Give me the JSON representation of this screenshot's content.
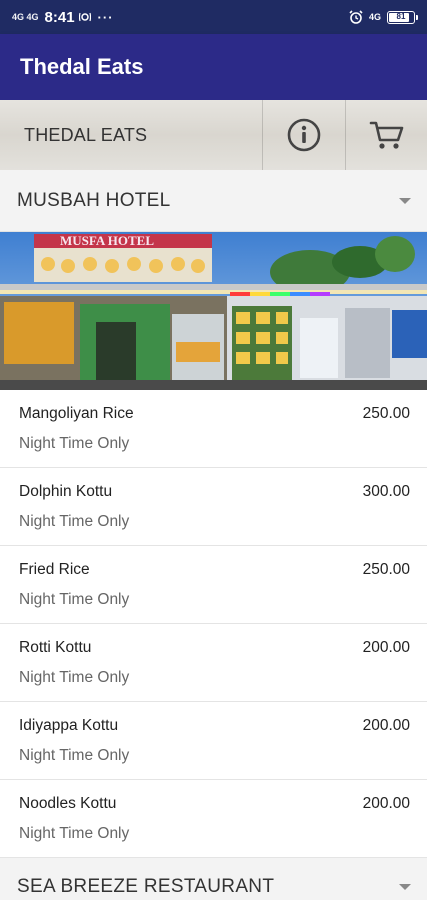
{
  "status_bar": {
    "signal_text": "4G 4G",
    "time": "8:41",
    "more": "···",
    "network": "4G",
    "battery": "81"
  },
  "app_bar": {
    "title": "Thedal Eats"
  },
  "toolbar": {
    "title": "THEDAL EATS",
    "info_icon": "info-icon",
    "cart_icon": "cart-icon"
  },
  "restaurants": [
    {
      "name": "MUSBAH HOTEL",
      "sign_text": "MUSFA HOTEL",
      "items": [
        {
          "name": "Mangoliyan Rice",
          "price": "250.00",
          "note": "Night Time Only"
        },
        {
          "name": "Dolphin Kottu",
          "price": "300.00",
          "note": "Night Time Only"
        },
        {
          "name": "Fried Rice",
          "price": "250.00",
          "note": "Night Time Only"
        },
        {
          "name": "Rotti Kottu",
          "price": "200.00",
          "note": "Night Time Only"
        },
        {
          "name": "Idiyappa Kottu",
          "price": "200.00",
          "note": "Night Time Only"
        },
        {
          "name": "Noodles Kottu",
          "price": "200.00",
          "note": "Night Time Only"
        }
      ]
    },
    {
      "name": "SEA BREEZE RESTAURANT"
    }
  ],
  "colors": {
    "status_bar": "#1f2b63",
    "app_bar": "#2c2a88",
    "section_bg": "#f3f3f3"
  }
}
